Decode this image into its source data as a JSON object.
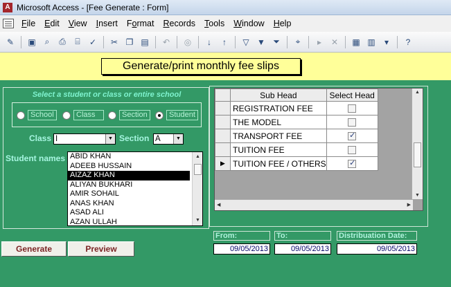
{
  "window": {
    "title": "Microsoft Access - [Fee Generate : Form]"
  },
  "menu": {
    "items": [
      {
        "pre": "",
        "acc": "F",
        "post": "ile"
      },
      {
        "pre": "",
        "acc": "E",
        "post": "dit"
      },
      {
        "pre": "",
        "acc": "V",
        "post": "iew"
      },
      {
        "pre": "",
        "acc": "I",
        "post": "nsert"
      },
      {
        "pre": "F",
        "acc": "o",
        "post": "rmat"
      },
      {
        "pre": "",
        "acc": "R",
        "post": "ecords"
      },
      {
        "pre": "",
        "acc": "T",
        "post": "ools"
      },
      {
        "pre": "",
        "acc": "W",
        "post": "indow"
      },
      {
        "pre": "",
        "acc": "H",
        "post": "elp"
      }
    ]
  },
  "form": {
    "title": "Generate/print monthly fee slips",
    "select_caption": "Select a student or class or entire school",
    "scope": {
      "options": [
        "School",
        "Class",
        "Section",
        "Student"
      ],
      "selected": "Student"
    },
    "class_label": "Class",
    "class_value": "I",
    "section_label": "Section",
    "section_value": "A",
    "students_label": "Student names",
    "students": [
      "ABID KHAN",
      "ADEEB HUSSAIN",
      "AIZAZ KHAN",
      "ALIYAN BUKHARI",
      "AMIR SOHAIL",
      "ANAS KHAN",
      "ASAD ALI",
      "AZAN ULLAH"
    ],
    "selected_student": "AIZAZ KHAN",
    "grid": {
      "headers": [
        "Sub Head",
        "Select Head"
      ],
      "rows": [
        {
          "name": "REGISTRATION FEE",
          "checked": false,
          "current": false
        },
        {
          "name": "THE MODEL",
          "checked": false,
          "current": false
        },
        {
          "name": "TRANSPORT FEE",
          "checked": true,
          "current": false
        },
        {
          "name": "TUITION FEE",
          "checked": false,
          "current": false
        },
        {
          "name": "TUITION FEE / OTHERS",
          "checked": true,
          "current": true
        }
      ]
    },
    "from_label": "From:",
    "from_value": "09/05/2013",
    "to_label": "To:",
    "to_value": "09/05/2013",
    "dist_label": "Distribuation Date:",
    "dist_value": "09/05/2013",
    "generate_label": "Generate",
    "preview_label": "Preview"
  },
  "colors": {
    "form_bg": "#339966",
    "header_bg": "#ffff99",
    "button_text": "#7b2424"
  }
}
